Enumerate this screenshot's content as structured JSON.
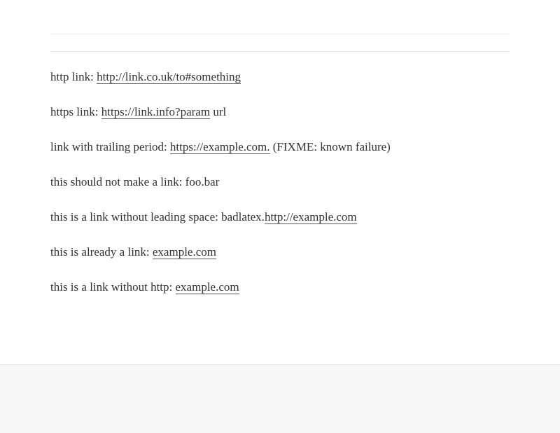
{
  "lines": [
    {
      "prefix": "http link: ",
      "link": "http://link.co.uk/to#something",
      "suffix": ""
    },
    {
      "prefix": "https link: ",
      "link": "https://link.info?param",
      "suffix": " url"
    },
    {
      "prefix": "link with trailing period: ",
      "link": "https://example.com.",
      "suffix": " (FIXME: known failure)"
    },
    {
      "text": "this should not make a link: foo.bar"
    },
    {
      "prefix": "this is a link without leading space: badlatex.",
      "link": "http://example.com",
      "suffix": ""
    },
    {
      "prefix": "this is already a link: ",
      "link": "example.com",
      "suffix": ""
    },
    {
      "prefix": "this is a link without http: ",
      "link": "example.com",
      "suffix": ""
    }
  ]
}
